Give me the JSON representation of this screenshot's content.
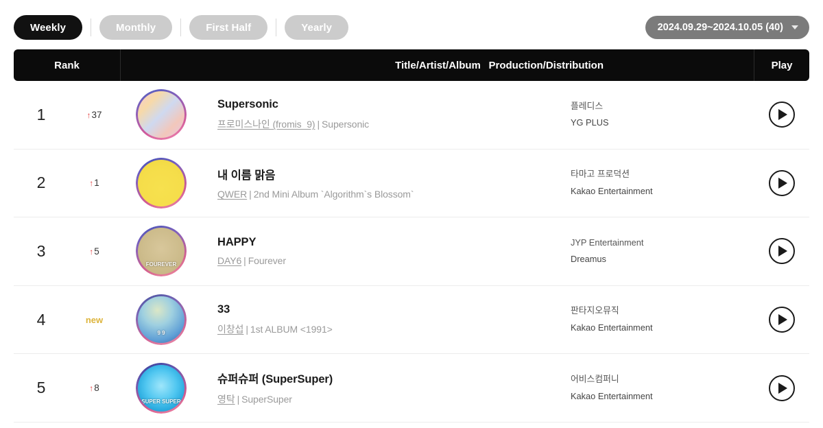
{
  "tabs": [
    {
      "label": "Weekly",
      "active": true
    },
    {
      "label": "Monthly",
      "active": false
    },
    {
      "label": "First Half",
      "active": false
    },
    {
      "label": "Yearly",
      "active": false
    }
  ],
  "date_selector": {
    "label": "2024.09.29~2024.10.05 (40)",
    "icon": "chevron-down-icon"
  },
  "table": {
    "headers": {
      "rank": "Rank",
      "title": "Title/Artist/Album",
      "production": "Production/Distribution",
      "play": "Play"
    },
    "rows": [
      {
        "rank": "1",
        "change_type": "up",
        "change_value": "37",
        "change_arrow": "↑",
        "title": "Supersonic",
        "artist": "프로미스나인 (fromis_9)",
        "album": "Supersonic",
        "production": "플레디스",
        "distribution": "YG PLUS",
        "play_label": "play-button",
        "art": {
          "bg": "linear-gradient(135deg,#f3c9d8 0%,#f7d9a8 25%,#cfd9f0 50%,#f2c7bb 75%,#e6c6e2 100%)",
          "ring": "linear-gradient(160deg,#4a5fc1 0%,#8e5fb8 35%,#d15a9a 70%,#f28ab0 100%)",
          "caption": ""
        }
      },
      {
        "rank": "2",
        "change_type": "up",
        "change_value": "1",
        "change_arrow": "↑",
        "title": "내 이름 맑음",
        "artist": "QWER",
        "album": "2nd Mini Album `Algorithm`s Blossom`",
        "production": "타마고 프로덕션",
        "distribution": "Kakao Entertainment",
        "play_label": "play-button",
        "art": {
          "bg": "radial-gradient(circle at 50% 62%, #f7e14e 0%, #f5dd4a 60%, #efd53f 100%)",
          "ring": "linear-gradient(160deg,#3b4fb5 0%,#7a5fc0 30%,#d05a92 70%,#f08aa8 100%)",
          "caption": ""
        }
      },
      {
        "rank": "3",
        "change_type": "up",
        "change_value": "5",
        "change_arrow": "↑",
        "title": "HAPPY",
        "artist": "DAY6",
        "album": "Fourever",
        "production": "JYP Entertainment",
        "distribution": "Dreamus",
        "play_label": "play-button",
        "art": {
          "bg": "radial-gradient(circle at 50% 45%, #d8c79b 0%, #cdbc8c 55%, #c2b07e 100%)",
          "ring": "linear-gradient(160deg,#3f52b5 0%,#8060bd 30%,#d3608f 70%,#f2909f 100%)",
          "caption": "FOUREVER"
        }
      },
      {
        "rank": "4",
        "change_type": "new",
        "change_value": "new",
        "change_arrow": "",
        "title": "33",
        "artist": "이창섭",
        "album": "1st ALBUM <1991>",
        "production": "판타지오뮤직",
        "distribution": "Kakao Entertainment",
        "play_label": "play-button",
        "art": {
          "bg": "radial-gradient(circle at 42% 30%, #dbe7c6 0%, #9fd0e0 35%, #5f9fd6 70%, #2f5f9e 100%)",
          "ring": "linear-gradient(160deg,#42549f 0%,#7a64b5 30%,#cf6396 70%,#ef92aa 100%)",
          "caption": "9    9"
        }
      },
      {
        "rank": "5",
        "change_type": "up",
        "change_value": "8",
        "change_arrow": "↑",
        "title": "슈퍼슈퍼 (SuperSuper)",
        "artist": "영탁",
        "album": "SuperSuper",
        "production": "어비스컴퍼니",
        "distribution": "Kakao Entertainment",
        "play_label": "play-button",
        "art": {
          "bg": "radial-gradient(circle at 50% 45%, #9fe6fb 0%, #4fc6f0 45%, #1b9fd8 80%, #0d78b5 100%)",
          "ring": "linear-gradient(160deg,#2b3f9c 0%,#6f57ae 30%,#d05a8e 70%,#f08aa6 100%)",
          "caption": "SUPER SUPER"
        }
      }
    ]
  },
  "colors": {
    "accent_active_tab": "#111111",
    "inactive_tab": "#cccccc",
    "date_pill": "#7b7b7b",
    "header_bg": "#0b0b0b",
    "rank_up": "#e23b3b",
    "rank_new": "#ddb43c",
    "subtext": "#9a9a9a"
  }
}
